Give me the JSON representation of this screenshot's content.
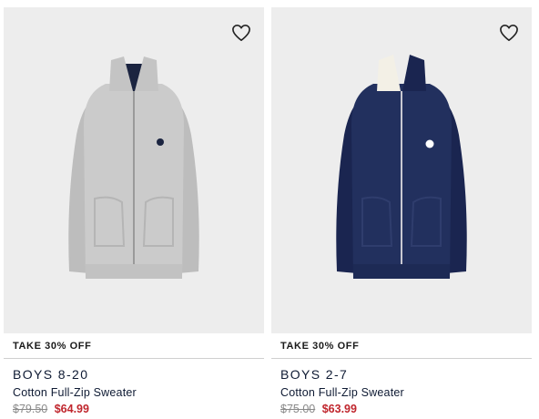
{
  "products": [
    {
      "promo": "TAKE 30% OFF",
      "category": "BOYS 8-20",
      "name": "Cotton Full-Zip Sweater",
      "original_price": "$79.50",
      "sale_price": "$64.99",
      "color": "#c9c9c9",
      "icon": "heart-icon"
    },
    {
      "promo": "TAKE 30% OFF",
      "category": "BOYS 2-7",
      "name": "Cotton Full-Zip Sweater",
      "original_price": "$75.00",
      "sale_price": "$63.99",
      "color": "#1e2a55",
      "icon": "heart-icon"
    }
  ]
}
